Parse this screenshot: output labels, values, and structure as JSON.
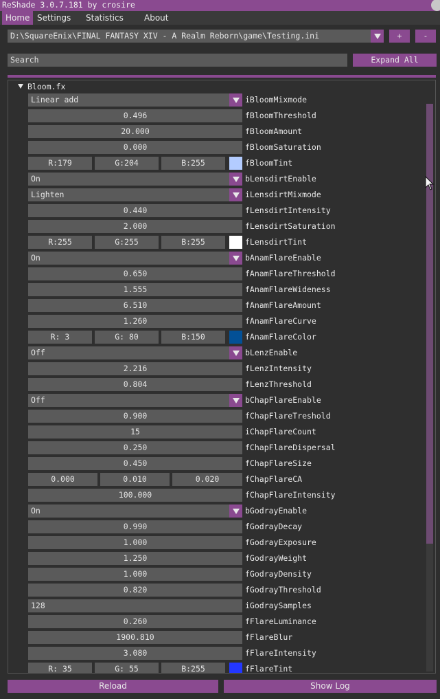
{
  "window": {
    "title": "ReShade 3.0.7.181 by crosire"
  },
  "menu": [
    "Home",
    "Settings",
    "Statistics",
    "About"
  ],
  "preset": {
    "path": "D:\\SquareEnix\\FINAL FANTASY XIV - A Realm Reborn\\game\\Testing.ini",
    "add_label": "+",
    "remove_label": "-"
  },
  "search": {
    "placeholder": "Search"
  },
  "expand_label": "Expand All",
  "section": {
    "title": "Bloom.fx"
  },
  "params": [
    {
      "type": "combo",
      "value": "Linear add",
      "label": "iBloomMixmode"
    },
    {
      "type": "num",
      "value": "0.496",
      "label": "fBloomThreshold"
    },
    {
      "type": "num",
      "value": "20.000",
      "label": "fBloomAmount"
    },
    {
      "type": "num",
      "value": "0.000",
      "label": "fBloomSaturation"
    },
    {
      "type": "color",
      "r": "R:179",
      "g": "G:204",
      "b": "B:255",
      "swatch": "#b3ccff",
      "label": "fBloomTint"
    },
    {
      "type": "combo",
      "value": "On",
      "label": "bLensdirtEnable"
    },
    {
      "type": "combo",
      "value": "Lighten",
      "label": "iLensdirtMixmode"
    },
    {
      "type": "num",
      "value": "0.440",
      "label": "fLensdirtIntensity"
    },
    {
      "type": "num",
      "value": "2.000",
      "label": "fLensdirtSaturation"
    },
    {
      "type": "color",
      "r": "R:255",
      "g": "G:255",
      "b": "B:255",
      "swatch": "#ffffff",
      "label": "fLensdirtTint"
    },
    {
      "type": "combo",
      "value": "On",
      "label": "bAnamFlareEnable"
    },
    {
      "type": "num",
      "value": "0.650",
      "label": "fAnamFlareThreshold"
    },
    {
      "type": "num",
      "value": "1.555",
      "label": "fAnamFlareWideness"
    },
    {
      "type": "num",
      "value": "6.510",
      "label": "fAnamFlareAmount"
    },
    {
      "type": "num",
      "value": "1.260",
      "label": "fAnamFlareCurve"
    },
    {
      "type": "color",
      "r": "R:  3",
      "g": "G: 80",
      "b": "B:150",
      "swatch": "#035096",
      "label": "fAnamFlareColor"
    },
    {
      "type": "combo",
      "value": "Off",
      "label": "bLenzEnable"
    },
    {
      "type": "num",
      "value": "2.216",
      "label": "fLenzIntensity"
    },
    {
      "type": "num",
      "value": "0.804",
      "label": "fLenzThreshold"
    },
    {
      "type": "combo",
      "value": "Off",
      "label": "bChapFlareEnable"
    },
    {
      "type": "num",
      "value": "0.900",
      "label": "fChapFlareTreshold"
    },
    {
      "type": "num",
      "value": "15",
      "label": "iChapFlareCount"
    },
    {
      "type": "num",
      "value": "0.250",
      "label": "fChapFlareDispersal"
    },
    {
      "type": "num",
      "value": "0.450",
      "label": "fChapFlareSize"
    },
    {
      "type": "vec3",
      "a": "0.000",
      "b": "0.010",
      "c": "0.020",
      "label": "fChapFlareCA"
    },
    {
      "type": "num",
      "value": "100.000",
      "label": "fChapFlareIntensity"
    },
    {
      "type": "combo",
      "value": "On",
      "label": "bGodrayEnable"
    },
    {
      "type": "num",
      "value": "0.990",
      "label": "fGodrayDecay"
    },
    {
      "type": "num",
      "value": "1.000",
      "label": "fGodrayExposure"
    },
    {
      "type": "num",
      "value": "1.250",
      "label": "fGodrayWeight"
    },
    {
      "type": "num",
      "value": "1.000",
      "label": "fGodrayDensity"
    },
    {
      "type": "num",
      "value": "0.820",
      "label": "fGodrayThreshold"
    },
    {
      "type": "text",
      "value": "128",
      "label": "iGodraySamples"
    },
    {
      "type": "num",
      "value": "0.260",
      "label": "fFlareLuminance"
    },
    {
      "type": "num",
      "value": "1900.810",
      "label": "fFlareBlur"
    },
    {
      "type": "num",
      "value": "3.080",
      "label": "fFlareIntensity"
    },
    {
      "type": "color",
      "r": "R: 35",
      "g": "G: 55",
      "b": "B:255",
      "swatch": "#2337ff",
      "label": "fFlareTint"
    }
  ],
  "footer": {
    "reload_label": "Reload",
    "showlog_label": "Show Log"
  },
  "colors": {
    "accent": "#8a4a90",
    "field": "#5a5a5a",
    "background": "#2e2e2e"
  }
}
